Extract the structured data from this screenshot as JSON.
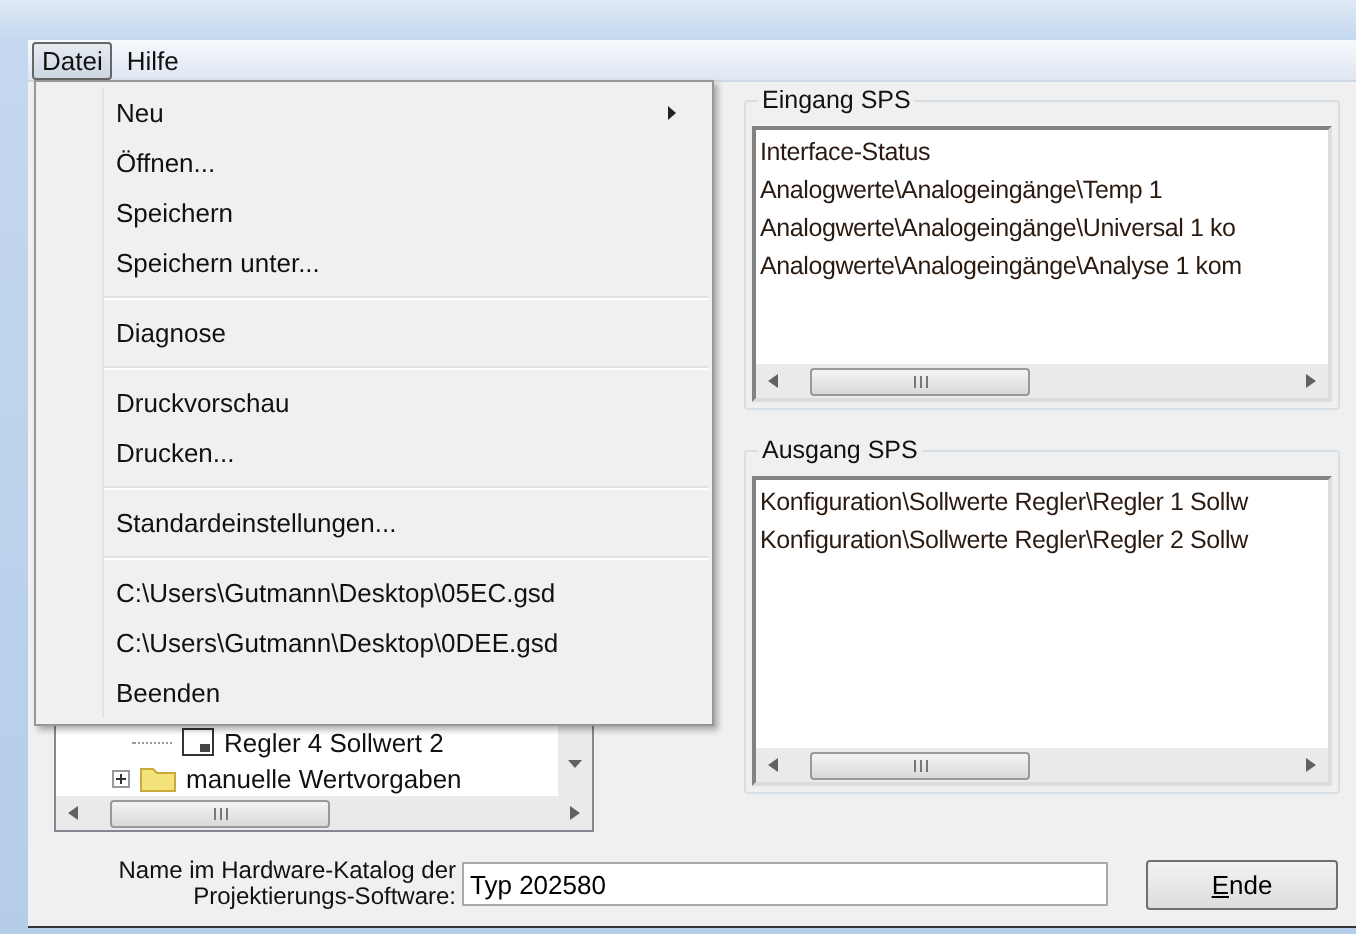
{
  "menu_bar": [
    {
      "label": "Datei",
      "selected": true
    },
    {
      "label": "Hilfe",
      "selected": false
    }
  ],
  "file_menu": [
    {
      "kind": "item",
      "label": "Neu",
      "submenu": true
    },
    {
      "kind": "item",
      "label": "Öffnen...",
      "submenu": false
    },
    {
      "kind": "item",
      "label": "Speichern",
      "submenu": false
    },
    {
      "kind": "item",
      "label": "Speichern unter...",
      "submenu": false
    },
    {
      "kind": "separator"
    },
    {
      "kind": "item",
      "label": "Diagnose",
      "submenu": false
    },
    {
      "kind": "separator"
    },
    {
      "kind": "item",
      "label": "Druckvorschau",
      "submenu": false
    },
    {
      "kind": "item",
      "label": "Drucken...",
      "submenu": false
    },
    {
      "kind": "separator"
    },
    {
      "kind": "item",
      "label": "Standardeinstellungen...",
      "submenu": false
    },
    {
      "kind": "separator"
    },
    {
      "kind": "item",
      "label": "C:\\Users\\Gutmann\\Desktop\\05EC.gsd",
      "submenu": false
    },
    {
      "kind": "item",
      "label": "C:\\Users\\Gutmann\\Desktop\\0DEE.gsd",
      "submenu": false
    },
    {
      "kind": "item",
      "label": "Beenden",
      "submenu": false
    }
  ],
  "tree": [
    {
      "kind": "value",
      "label": "Regler 4 Sollwert 2"
    },
    {
      "kind": "folder",
      "label": "manuelle Wertvorgaben",
      "expanded": false
    }
  ],
  "input_plc": {
    "title": "Eingang SPS",
    "rows": [
      "Interface-Status",
      "Analogwerte\\Analogeingänge\\Temp 1",
      "Analogwerte\\Analogeingänge\\Universal 1 ko",
      "Analogwerte\\Analogeingänge\\Analyse 1 kom"
    ]
  },
  "output_plc": {
    "title": "Ausgang SPS",
    "rows": [
      "Konfiguration\\Sollwerte Regler\\Regler 1 Sollw",
      "Konfiguration\\Sollwerte Regler\\Regler 2 Sollw"
    ]
  },
  "catalog_name": {
    "label": "Name im Hardware-Katalog der\nProjektierungs-Software:",
    "value": "Typ 202580"
  },
  "end_button": {
    "label": "Ende"
  }
}
